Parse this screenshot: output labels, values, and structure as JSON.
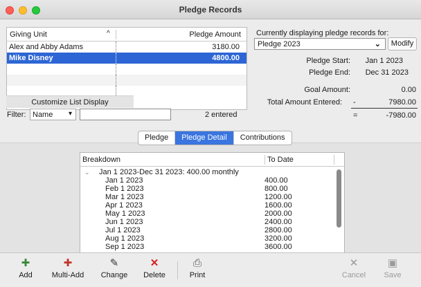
{
  "window": {
    "title": "Pledge Records"
  },
  "list": {
    "col_unit": "Giving Unit",
    "sort_indicator": "^",
    "col_amount": "Pledge Amount",
    "rows": [
      {
        "unit": "Alex and Abby Adams",
        "amount": "3180.00"
      },
      {
        "unit": "Mike Disney",
        "amount": "4800.00"
      }
    ],
    "customize_label": "Customize List Display"
  },
  "filter": {
    "label": "Filter:",
    "selected": "Name",
    "value": ""
  },
  "entered_text": "2 entered",
  "right": {
    "currently_label": "Currently displaying pledge records for:",
    "pledge_selected": "Pledge 2023",
    "modify_label": "Modify",
    "start_label": "Pledge Start:",
    "start_value": "Jan 1 2023",
    "end_label": "Pledge End:",
    "end_value": "Dec 31 2023",
    "goal_label": "Goal Amount:",
    "goal_value": "0.00",
    "total_label": "Total Amount Entered:",
    "total_sign": "-",
    "total_value": "7980.00",
    "result_sign": "=",
    "result_value": "-7980.00"
  },
  "tabs": [
    "Pledge",
    "Pledge Detail",
    "Contributions"
  ],
  "detail": {
    "col_breakdown": "Breakdown",
    "col_todate": "To Date",
    "group": "Jan 1 2023-Dec 31 2023: 400.00 monthly",
    "rows": [
      {
        "date": "Jan 1 2023",
        "value": "400.00"
      },
      {
        "date": "Feb 1 2023",
        "value": "800.00"
      },
      {
        "date": "Mar 1 2023",
        "value": "1200.00"
      },
      {
        "date": "Apr 1 2023",
        "value": "1600.00"
      },
      {
        "date": "May 1 2023",
        "value": "2000.00"
      },
      {
        "date": "Jun 1 2023",
        "value": "2400.00"
      },
      {
        "date": "Jul 1 2023",
        "value": "2800.00"
      },
      {
        "date": "Aug 1 2023",
        "value": "3200.00"
      },
      {
        "date": "Sep 1 2023",
        "value": "3600.00"
      }
    ]
  },
  "toolbar": {
    "add": "Add",
    "multi_add": "Multi-Add",
    "change": "Change",
    "delete": "Delete",
    "print": "Print",
    "cancel": "Cancel",
    "save": "Save"
  },
  "icons": {
    "add": "add-icon",
    "multi_add": "multi-add-icon",
    "change": "change-icon",
    "delete": "delete-x-icon",
    "print": "printer-icon",
    "cancel": "cancel-x-icon",
    "save": "save-icon"
  }
}
